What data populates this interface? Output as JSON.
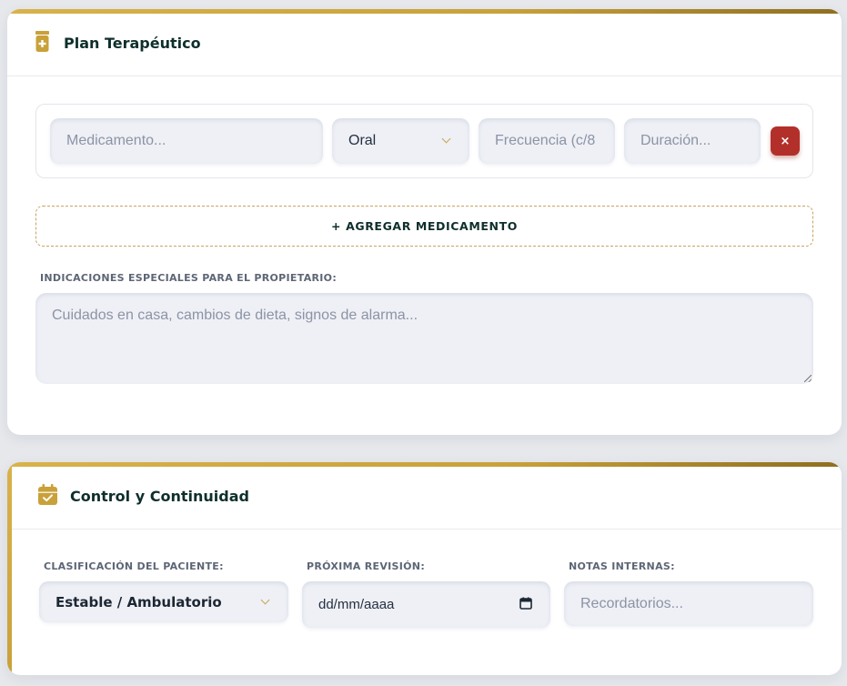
{
  "plan": {
    "title": "Plan Terapéutico",
    "icon": "medicine-bottle-icon",
    "medication_placeholder": "Medicamento...",
    "route_selected": "Oral",
    "frequency_placeholder": "Frecuencia (c/8",
    "duration_placeholder": "Duración...",
    "remove_label": "×",
    "add_label": "+ AGREGAR MEDICAMENTO",
    "indications_label": "INDICACIONES ESPECIALES PARA EL PROPIETARIO:",
    "indications_placeholder": "Cuidados en casa, cambios de dieta, signos de alarma..."
  },
  "control": {
    "title": "Control y Continuidad",
    "icon": "calendar-check-icon",
    "classification_label": "CLASIFICACIÓN DEL PACIENTE:",
    "classification_selected": "Estable / Ambulatorio",
    "next_review_label": "PRÓXIMA REVISIÓN:",
    "next_review_placeholder": "dd/mm/aaaa",
    "notes_label": "NOTAS INTERNAS:",
    "notes_placeholder": "Recordatorios..."
  },
  "colors": {
    "accent_gold": "#c9a13a",
    "title_dark_green": "#0e2f2c",
    "danger_red": "#b3302a",
    "input_bg": "#eef0f6"
  }
}
